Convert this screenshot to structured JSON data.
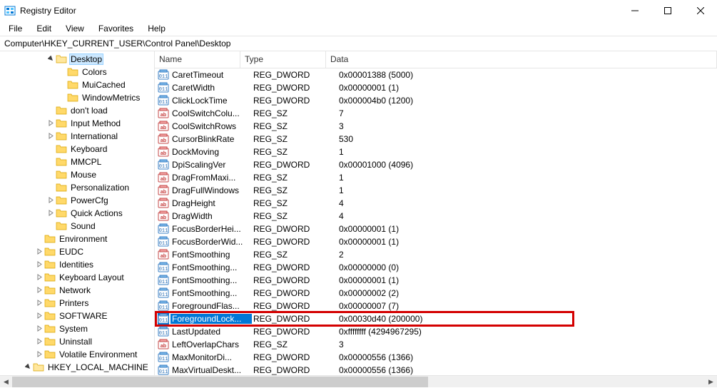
{
  "window": {
    "title": "Registry Editor"
  },
  "menu": {
    "file": "File",
    "edit": "Edit",
    "view": "View",
    "favorites": "Favorites",
    "help": "Help"
  },
  "address": "Computer\\HKEY_CURRENT_USER\\Control Panel\\Desktop",
  "columns": {
    "name": "Name",
    "type": "Type",
    "data": "Data"
  },
  "tree": [
    {
      "label": "Desktop",
      "depth": 4,
      "expand": "open",
      "selected": true
    },
    {
      "label": "Colors",
      "depth": 5,
      "expand": "none"
    },
    {
      "label": "MuiCached",
      "depth": 5,
      "expand": "none"
    },
    {
      "label": "WindowMetrics",
      "depth": 5,
      "expand": "none"
    },
    {
      "label": "don't load",
      "depth": 4,
      "expand": "none"
    },
    {
      "label": "Input Method",
      "depth": 4,
      "expand": "closed"
    },
    {
      "label": "International",
      "depth": 4,
      "expand": "closed"
    },
    {
      "label": "Keyboard",
      "depth": 4,
      "expand": "none"
    },
    {
      "label": "MMCPL",
      "depth": 4,
      "expand": "none"
    },
    {
      "label": "Mouse",
      "depth": 4,
      "expand": "none"
    },
    {
      "label": "Personalization",
      "depth": 4,
      "expand": "none"
    },
    {
      "label": "PowerCfg",
      "depth": 4,
      "expand": "closed"
    },
    {
      "label": "Quick Actions",
      "depth": 4,
      "expand": "closed"
    },
    {
      "label": "Sound",
      "depth": 4,
      "expand": "none"
    },
    {
      "label": "Environment",
      "depth": 3,
      "expand": "none"
    },
    {
      "label": "EUDC",
      "depth": 3,
      "expand": "closed"
    },
    {
      "label": "Identities",
      "depth": 3,
      "expand": "closed"
    },
    {
      "label": "Keyboard Layout",
      "depth": 3,
      "expand": "closed"
    },
    {
      "label": "Network",
      "depth": 3,
      "expand": "closed"
    },
    {
      "label": "Printers",
      "depth": 3,
      "expand": "closed"
    },
    {
      "label": "SOFTWARE",
      "depth": 3,
      "expand": "closed"
    },
    {
      "label": "System",
      "depth": 3,
      "expand": "closed"
    },
    {
      "label": "Uninstall",
      "depth": 3,
      "expand": "closed"
    },
    {
      "label": "Volatile Environment",
      "depth": 3,
      "expand": "closed"
    },
    {
      "label": "HKEY_LOCAL_MACHINE",
      "depth": 2,
      "expand": "open"
    }
  ],
  "values": [
    {
      "name": "CaretTimeout",
      "type": "REG_DWORD",
      "data": "0x00001388 (5000)",
      "icon": "bin"
    },
    {
      "name": "CaretWidth",
      "type": "REG_DWORD",
      "data": "0x00000001 (1)",
      "icon": "bin"
    },
    {
      "name": "ClickLockTime",
      "type": "REG_DWORD",
      "data": "0x000004b0 (1200)",
      "icon": "bin"
    },
    {
      "name": "CoolSwitchColu...",
      "type": "REG_SZ",
      "data": "7",
      "icon": "str"
    },
    {
      "name": "CoolSwitchRows",
      "type": "REG_SZ",
      "data": "3",
      "icon": "str"
    },
    {
      "name": "CursorBlinkRate",
      "type": "REG_SZ",
      "data": "530",
      "icon": "str"
    },
    {
      "name": "DockMoving",
      "type": "REG_SZ",
      "data": "1",
      "icon": "str"
    },
    {
      "name": "DpiScalingVer",
      "type": "REG_DWORD",
      "data": "0x00001000 (4096)",
      "icon": "bin"
    },
    {
      "name": "DragFromMaxi...",
      "type": "REG_SZ",
      "data": "1",
      "icon": "str"
    },
    {
      "name": "DragFullWindows",
      "type": "REG_SZ",
      "data": "1",
      "icon": "str"
    },
    {
      "name": "DragHeight",
      "type": "REG_SZ",
      "data": "4",
      "icon": "str"
    },
    {
      "name": "DragWidth",
      "type": "REG_SZ",
      "data": "4",
      "icon": "str"
    },
    {
      "name": "FocusBorderHei...",
      "type": "REG_DWORD",
      "data": "0x00000001 (1)",
      "icon": "bin"
    },
    {
      "name": "FocusBorderWid...",
      "type": "REG_DWORD",
      "data": "0x00000001 (1)",
      "icon": "bin"
    },
    {
      "name": "FontSmoothing",
      "type": "REG_SZ",
      "data": "2",
      "icon": "str"
    },
    {
      "name": "FontSmoothing...",
      "type": "REG_DWORD",
      "data": "0x00000000 (0)",
      "icon": "bin"
    },
    {
      "name": "FontSmoothing...",
      "type": "REG_DWORD",
      "data": "0x00000001 (1)",
      "icon": "bin"
    },
    {
      "name": "FontSmoothing...",
      "type": "REG_DWORD",
      "data": "0x00000002 (2)",
      "icon": "bin"
    },
    {
      "name": "ForegroundFlas...",
      "type": "REG_DWORD",
      "data": "0x00000007 (7)",
      "icon": "bin"
    },
    {
      "name": "ForegroundLock...",
      "type": "REG_DWORD",
      "data": "0x00030d40 (200000)",
      "icon": "bin",
      "highlighted": true
    },
    {
      "name": "LastUpdated",
      "type": "REG_DWORD",
      "data": "0xffffffff (4294967295)",
      "icon": "bin"
    },
    {
      "name": "LeftOverlapChars",
      "type": "REG_SZ",
      "data": "3",
      "icon": "str"
    },
    {
      "name": "MaxMonitorDi...",
      "type": "REG_DWORD",
      "data": "0x00000556 (1366)",
      "icon": "bin"
    },
    {
      "name": "MaxVirtualDeskt...",
      "type": "REG_DWORD",
      "data": "0x00000556 (1366)",
      "icon": "bin"
    }
  ]
}
